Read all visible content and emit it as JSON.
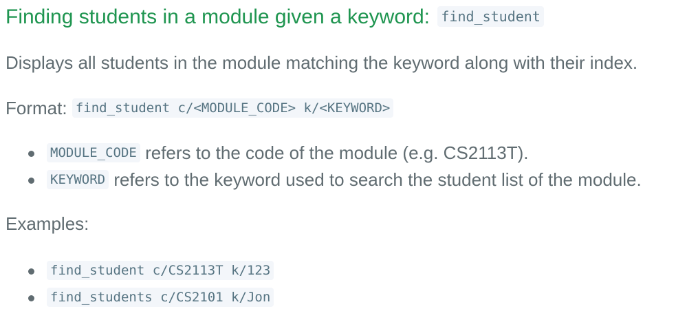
{
  "heading": {
    "text": "Finding students in a module given a keyword:",
    "code": "find_student"
  },
  "description": "Displays all students in the module matching the keyword along with their index.",
  "format": {
    "label": "Format:",
    "code": "find_student c/<MODULE_CODE> k/<KEYWORD>"
  },
  "params": [
    {
      "code": "MODULE_CODE",
      "text": "refers to the code of the module (e.g. CS2113T)."
    },
    {
      "code": "KEYWORD",
      "text": "refers to the keyword used to search the student list of the module."
    }
  ],
  "examples_label": "Examples:",
  "examples": [
    "find_student c/CS2113T k/123",
    "find_students c/CS2101 k/Jon"
  ]
}
